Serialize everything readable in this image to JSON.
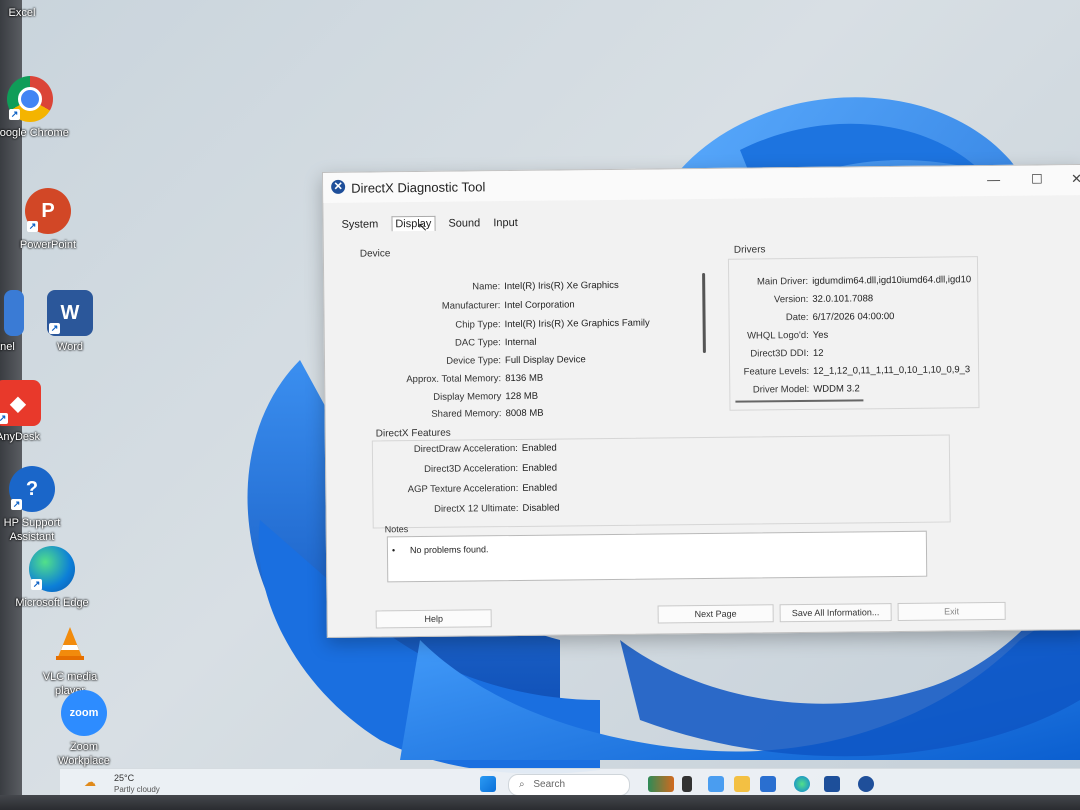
{
  "desktop": {
    "icons": [
      {
        "label": "Excel"
      },
      {
        "label": "Google Chrome"
      },
      {
        "label": "PowerPoint"
      },
      {
        "label": "l Panel"
      },
      {
        "label": "Word"
      },
      {
        "label": "AnyDesk"
      },
      {
        "label": "HP Support Assistant"
      },
      {
        "label": "Microsoft Edge"
      },
      {
        "label": "VLC media player"
      },
      {
        "label": "Zoom Workplace"
      }
    ]
  },
  "window": {
    "title": "DirectX Diagnostic Tool",
    "tabs": [
      "System",
      "Display",
      "Sound",
      "Input"
    ],
    "active_tab": "Display",
    "device": {
      "heading": "Device",
      "rows": [
        {
          "k": "Name:",
          "v": "Intel(R) Iris(R) Xe Graphics"
        },
        {
          "k": "Manufacturer:",
          "v": "Intel Corporation"
        },
        {
          "k": "Chip Type:",
          "v": "Intel(R) Iris(R) Xe Graphics Family"
        },
        {
          "k": "DAC Type:",
          "v": "Internal"
        },
        {
          "k": "Device Type:",
          "v": "Full Display Device"
        },
        {
          "k": "Approx. Total Memory:",
          "v": "8136 MB"
        },
        {
          "k": "Display Memory",
          "v": "128 MB"
        },
        {
          "k": "Shared Memory:",
          "v": "8008 MB"
        }
      ]
    },
    "drivers": {
      "heading": "Drivers",
      "rows": [
        {
          "k": "Main Driver:",
          "v": "igdumdim64.dll,igd10iumd64.dll,igd10"
        },
        {
          "k": "Version:",
          "v": "32.0.101.7088"
        },
        {
          "k": "Date:",
          "v": "6/17/2026 04:00:00"
        },
        {
          "k": "WHQL Logo'd:",
          "v": "Yes"
        },
        {
          "k": "Direct3D DDI:",
          "v": "12"
        },
        {
          "k": "Feature Levels:",
          "v": "12_1,12_0,11_1,11_0,10_1,10_0,9_3"
        },
        {
          "k": "Driver Model:",
          "v": "WDDM 3.2"
        }
      ]
    },
    "features": {
      "heading": "DirectX Features",
      "rows": [
        {
          "k": "DirectDraw Acceleration:",
          "v": "Enabled"
        },
        {
          "k": "Direct3D Acceleration:",
          "v": "Enabled"
        },
        {
          "k": "AGP Texture Acceleration:",
          "v": "Enabled"
        },
        {
          "k": "DirectX 12 Ultimate:",
          "v": "Disabled"
        }
      ]
    },
    "notes": {
      "heading": "Notes",
      "items": [
        "No problems found."
      ]
    },
    "buttons": {
      "help": "Help",
      "next_page": "Next Page",
      "save_all": "Save All Information...",
      "exit": "Exit"
    }
  },
  "taskbar": {
    "weather_temp": "25°C",
    "weather_desc": "Partly cloudy",
    "search_placeholder": "Search"
  }
}
